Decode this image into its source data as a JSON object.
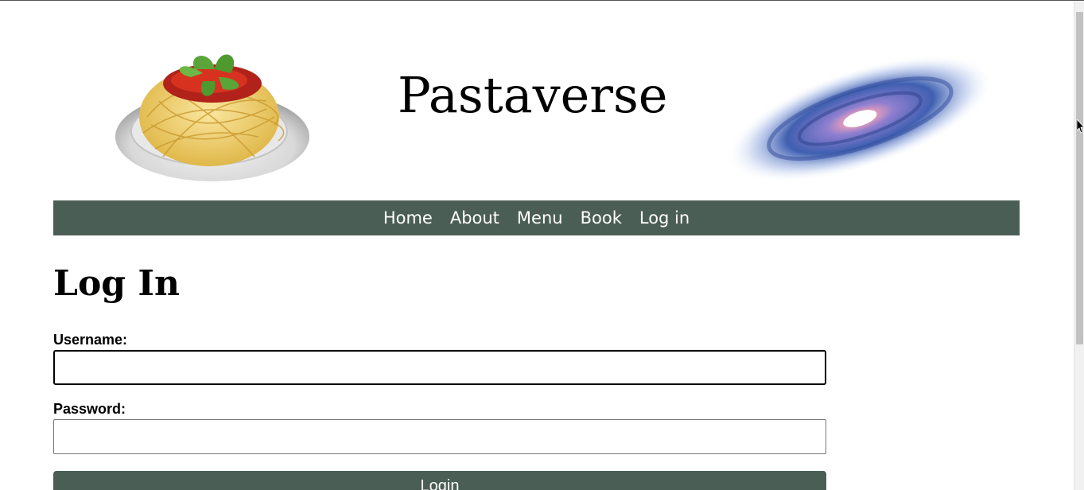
{
  "site": {
    "title": "Pastaverse",
    "logo_left_icon": "spaghetti-plate-icon",
    "logo_right_icon": "galaxy-icon"
  },
  "nav": {
    "items": [
      {
        "label": "Home"
      },
      {
        "label": "About"
      },
      {
        "label": "Menu"
      },
      {
        "label": "Book"
      },
      {
        "label": "Log in"
      }
    ]
  },
  "main": {
    "heading": "Log In",
    "username_label": "Username:",
    "username_value": "",
    "password_label": "Password:",
    "password_value": "",
    "submit_label": "Login"
  },
  "colors": {
    "nav_bg": "#4b5e56",
    "nav_text": "#ffffff",
    "button_bg": "#4b5e56"
  }
}
